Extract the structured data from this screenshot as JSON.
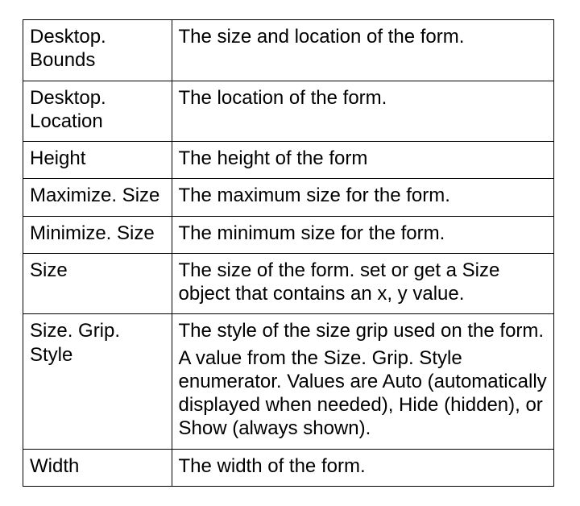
{
  "rows": [
    {
      "prop": "Desktop. Bounds",
      "desc": [
        "The size and location of the form."
      ]
    },
    {
      "prop": "Desktop. Location",
      "desc": [
        "The location of the form."
      ]
    },
    {
      "prop": "Height",
      "desc": [
        "The height of the form"
      ]
    },
    {
      "prop": "Maximize. Size",
      "desc": [
        "The maximum size for the form."
      ]
    },
    {
      "prop": "Minimize. Size",
      "desc": [
        "The minimum size for the form."
      ]
    },
    {
      "prop": "Size",
      "desc": [
        "The size of the form. set or get a Size object that contains an x, y value."
      ]
    },
    {
      "prop": "Size. Grip. Style",
      "desc": [
        "The style of the size grip used on the form.",
        "A value from the Size. Grip. Style enumerator. Values are Auto (automatically displayed when needed), Hide (hidden), or Show (always shown)."
      ]
    },
    {
      "prop": "Width",
      "desc": [
        "The width of the form."
      ]
    }
  ]
}
